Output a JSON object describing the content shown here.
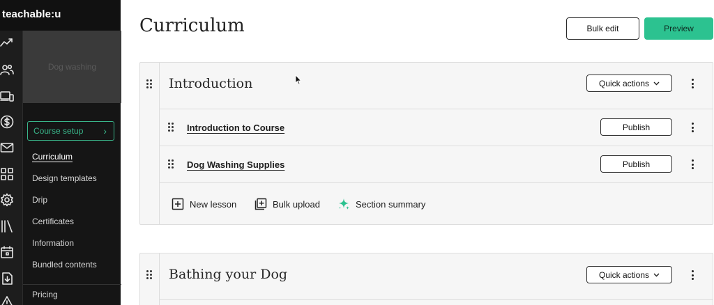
{
  "brand": "teachable:u",
  "rail_icons": [
    "analytics-icon",
    "users-icon",
    "devices-icon",
    "dollar-icon",
    "mail-icon",
    "apps-grid-icon",
    "settings-gear-icon",
    "library-icon",
    "calendar-icon",
    "download-icon",
    "warning-icon"
  ],
  "course": {
    "thumbnail_text": "Dog washing",
    "setup_label": "Course setup",
    "nav": [
      {
        "label": "Curriculum",
        "active": true
      },
      {
        "label": "Design templates",
        "active": false
      },
      {
        "label": "Drip",
        "active": false
      },
      {
        "label": "Certificates",
        "active": false
      },
      {
        "label": "Information",
        "active": false
      },
      {
        "label": "Bundled contents",
        "active": false
      },
      {
        "label": "Pricing",
        "active": false
      }
    ]
  },
  "page": {
    "title": "Curriculum",
    "bulk_edit_label": "Bulk edit",
    "preview_label": "Preview"
  },
  "sections": [
    {
      "title": "Introduction",
      "quick_actions_label": "Quick actions",
      "lessons": [
        {
          "title": "Introduction to Course",
          "publish_label": "Publish"
        },
        {
          "title": "Dog Washing Supplies",
          "publish_label": "Publish"
        }
      ],
      "actions": {
        "new_lesson": "New lesson",
        "bulk_upload": "Bulk upload",
        "section_summary": "Section summary"
      }
    },
    {
      "title": "Bathing your Dog",
      "quick_actions_label": "Quick actions"
    }
  ],
  "colors": {
    "accent_green": "#2cc290",
    "sidebar_dark": "#151515",
    "setup_green": "#39b58a"
  }
}
